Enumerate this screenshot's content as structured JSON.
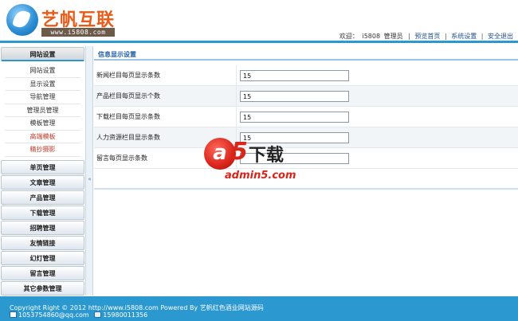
{
  "header": {
    "logo_text": "艺帆互联",
    "logo_url": "www.i5808.com",
    "welcome": "欢迎：",
    "username": "i5808",
    "role": "管理员",
    "nav": [
      "预览首页",
      "系统设置",
      "安全退出"
    ]
  },
  "sidebar": {
    "sections": [
      {
        "title": "网站设置",
        "active": true,
        "items": [
          "网站设置",
          "显示设置",
          "导航管理",
          "管理员管理",
          "模板管理",
          "高端模板",
          "精抄摄影"
        ]
      },
      {
        "title": "单页管理"
      },
      {
        "title": "文章管理"
      },
      {
        "title": "产品管理"
      },
      {
        "title": "下载管理"
      },
      {
        "title": "招聘管理"
      },
      {
        "title": "友情链接"
      },
      {
        "title": "幻灯管理"
      },
      {
        "title": "留言管理"
      },
      {
        "title": "其它参数管理"
      }
    ],
    "toggle_icon": "collapse-arrow-icon"
  },
  "main": {
    "panel_title": "信息显示设置",
    "fields": [
      {
        "label": "新闻栏目每页显示条数",
        "value": "15"
      },
      {
        "label": "产品栏目每页显示个数",
        "value": "15"
      },
      {
        "label": "下载栏目每页显示条数",
        "value": "15"
      },
      {
        "label": "人力资源栏目显示条数",
        "value": "15"
      },
      {
        "label": "留言每页显示条数",
        "value": ""
      }
    ]
  },
  "watermark": {
    "mark_a": "a",
    "mark_5": "5",
    "text": "下载",
    "url": "admin5.com"
  },
  "footer": {
    "copyright": "Copyright Right © 2012 http://www.i5808.com Powered By 艺帆红色酒业网站源码",
    "email": "1053754860@qq.com",
    "phone": "15980011356"
  },
  "colors": {
    "accent": "#2b98cf",
    "logo_orange": "#e85b18",
    "highlight_red": "#c0392b"
  }
}
